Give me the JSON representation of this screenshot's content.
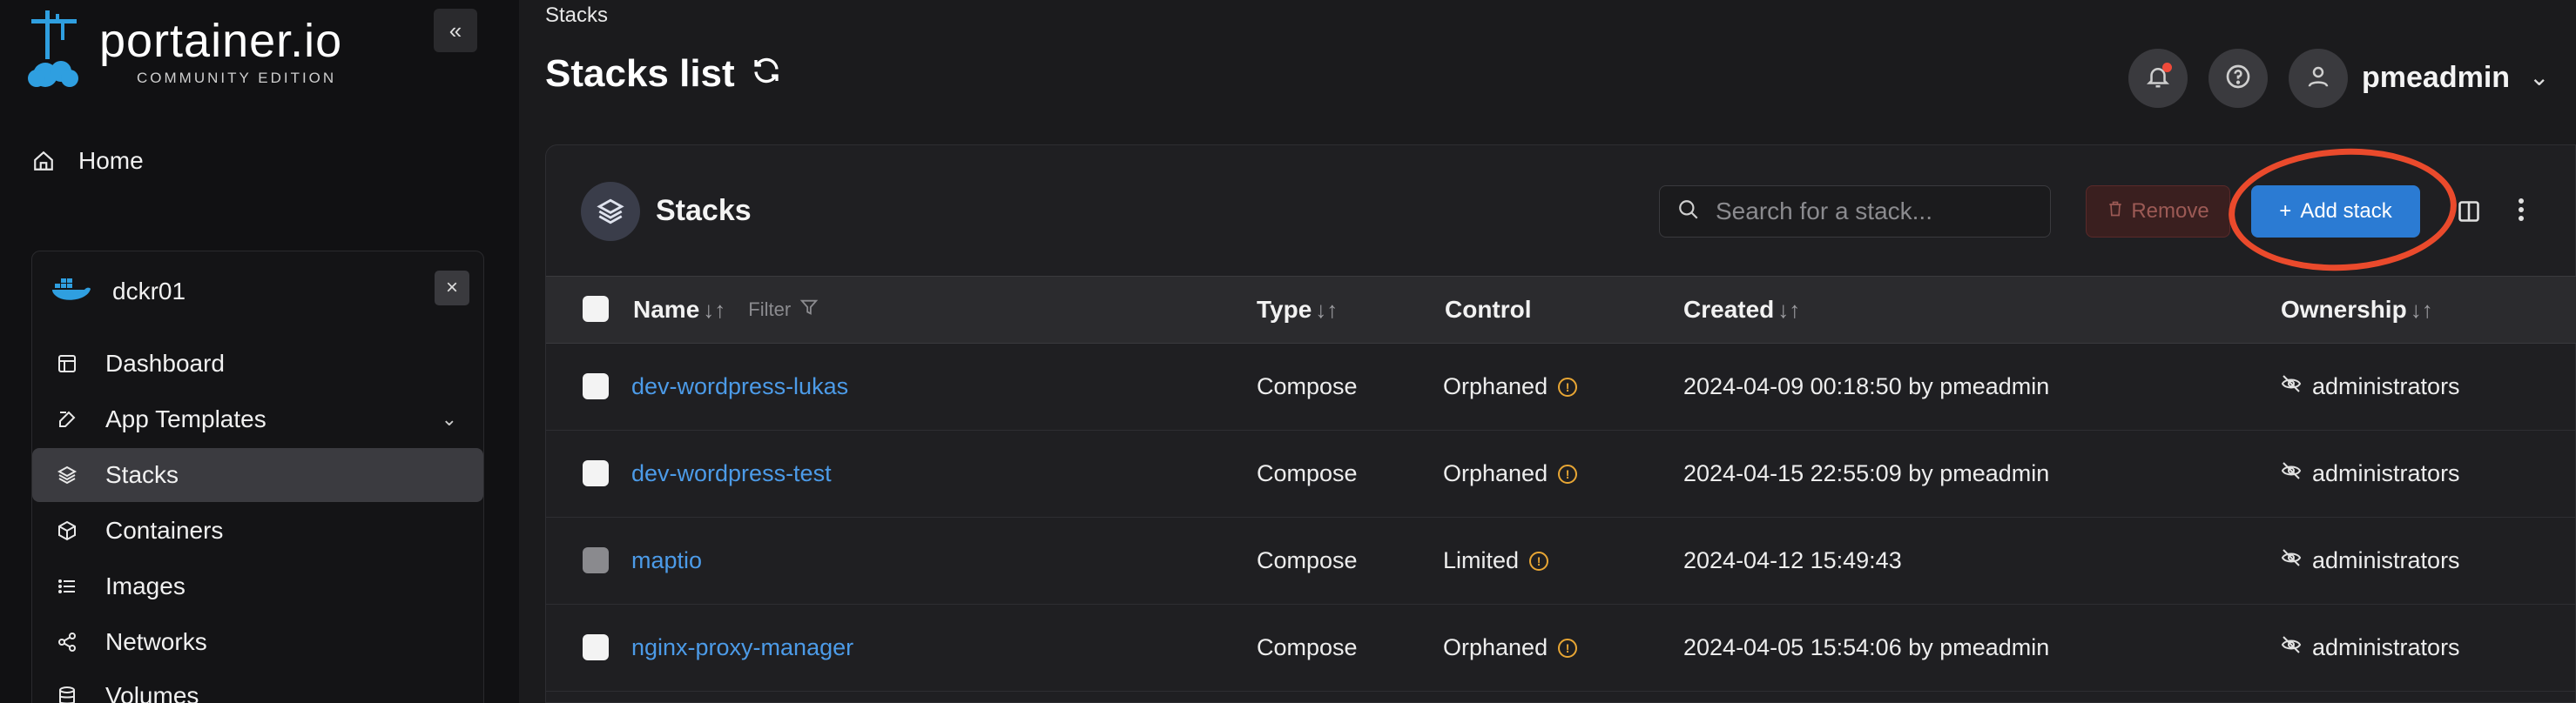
{
  "brand": {
    "name": "portainer.io",
    "edition": "COMMUNITY EDITION"
  },
  "sidebar": {
    "collapse_label": "«",
    "home_label": "Home",
    "environment": {
      "name": "dckr01",
      "close_label": "×"
    },
    "items": [
      {
        "label": "Dashboard",
        "icon": "dashboard-icon",
        "active": false
      },
      {
        "label": "App Templates",
        "icon": "edit-icon",
        "active": false
      },
      {
        "label": "Stacks",
        "icon": "layers-icon",
        "active": true
      },
      {
        "label": "Containers",
        "icon": "cube-icon",
        "active": false
      },
      {
        "label": "Images",
        "icon": "list-icon",
        "active": false
      },
      {
        "label": "Networks",
        "icon": "share-icon",
        "active": false
      },
      {
        "label": "Volumes",
        "icon": "database-icon",
        "active": false
      }
    ]
  },
  "header": {
    "breadcrumb": "Stacks",
    "title": "Stacks list",
    "username": "pmeadmin"
  },
  "panel": {
    "title": "Stacks",
    "search_placeholder": "Search for a stack...",
    "remove_label": "Remove",
    "add_label": "Add stack",
    "columns": {
      "name": "Name",
      "filter": "Filter",
      "type": "Type",
      "control": "Control",
      "created": "Created",
      "ownership": "Ownership"
    },
    "rows": [
      {
        "name": "dev-wordpress-lukas",
        "type": "Compose",
        "control": "Orphaned",
        "created": "2024-04-09 00:18:50 by pmeadmin",
        "ownership": "administrators",
        "disabled": false
      },
      {
        "name": "dev-wordpress-test",
        "type": "Compose",
        "control": "Orphaned",
        "created": "2024-04-15 22:55:09 by pmeadmin",
        "ownership": "administrators",
        "disabled": false
      },
      {
        "name": "maptio",
        "type": "Compose",
        "control": "Limited",
        "created": "2024-04-12 15:49:43",
        "ownership": "administrators",
        "disabled": true
      },
      {
        "name": "nginx-proxy-manager",
        "type": "Compose",
        "control": "Orphaned",
        "created": "2024-04-05 15:54:06 by pmeadmin",
        "ownership": "administrators",
        "disabled": false
      }
    ]
  },
  "colors": {
    "accent": "#2b7bd3",
    "link": "#4c9be8",
    "warning": "#e8a634",
    "annotation": "#ea4a2c"
  }
}
